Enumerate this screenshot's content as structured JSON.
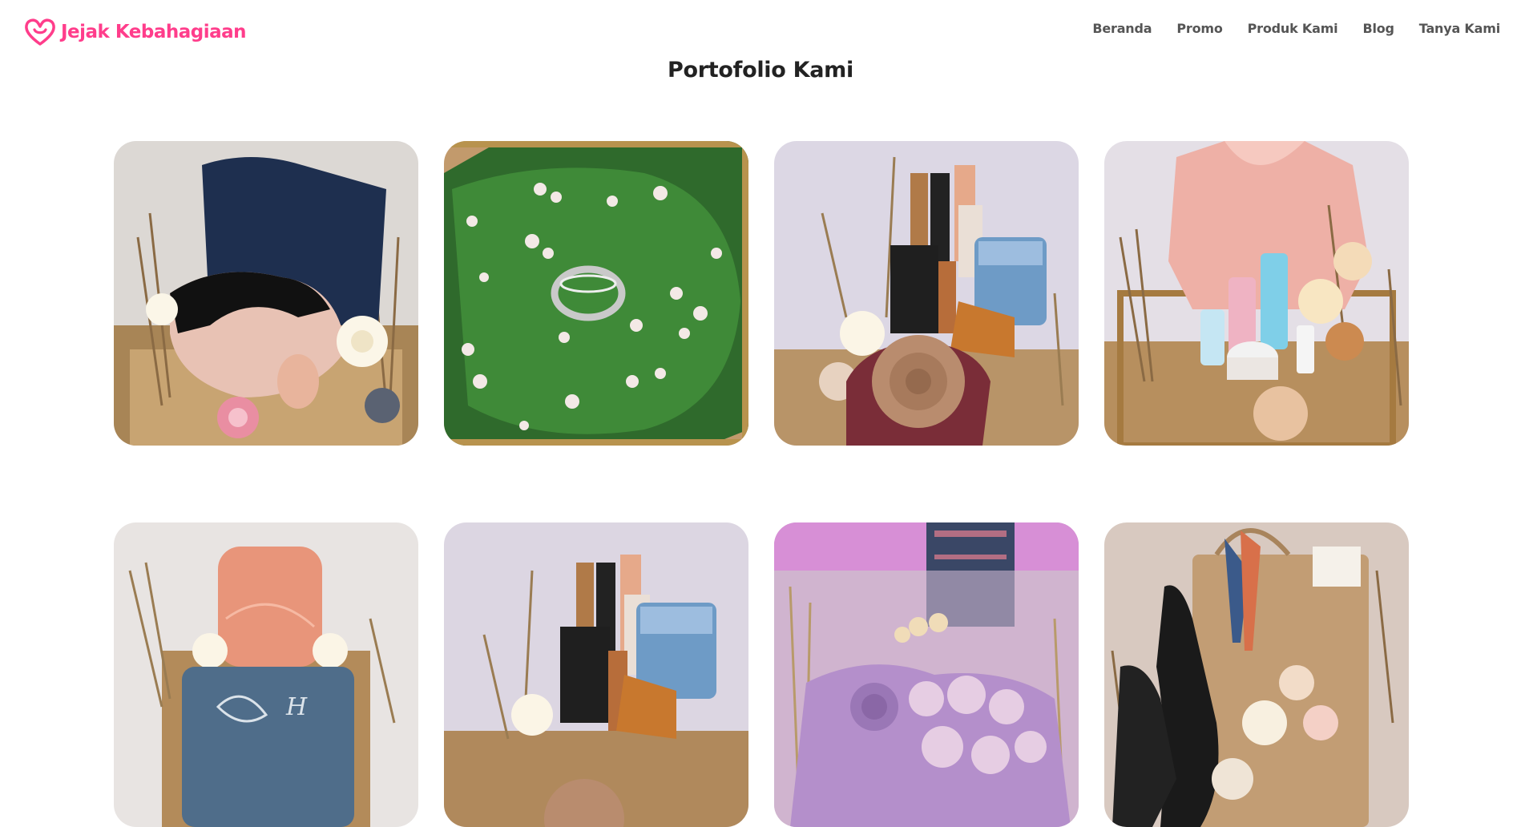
{
  "brand": {
    "name": "Jejak Kebahagiaan",
    "color": "#ff3d8b"
  },
  "nav": {
    "items": [
      {
        "label": "Beranda"
      },
      {
        "label": "Promo"
      },
      {
        "label": "Produk Kami"
      },
      {
        "label": "Blog"
      },
      {
        "label": "Tanya Kami"
      }
    ]
  },
  "page": {
    "title": "Portofolio Kami"
  },
  "portfolio": {
    "items": [
      {
        "subject": "hijab-hampers-navy-pink"
      },
      {
        "subject": "ring-box-moss-flowers"
      },
      {
        "subject": "cosmetics-hampers-hooman"
      },
      {
        "subject": "skincare-hampers-pink-robe"
      },
      {
        "subject": "towel-hampers-embroidered"
      },
      {
        "subject": "cosmetics-hampers-hooman-closeup"
      },
      {
        "subject": "acrylic-box-lilac-lace"
      },
      {
        "subject": "heels-bag-hampers"
      }
    ]
  }
}
